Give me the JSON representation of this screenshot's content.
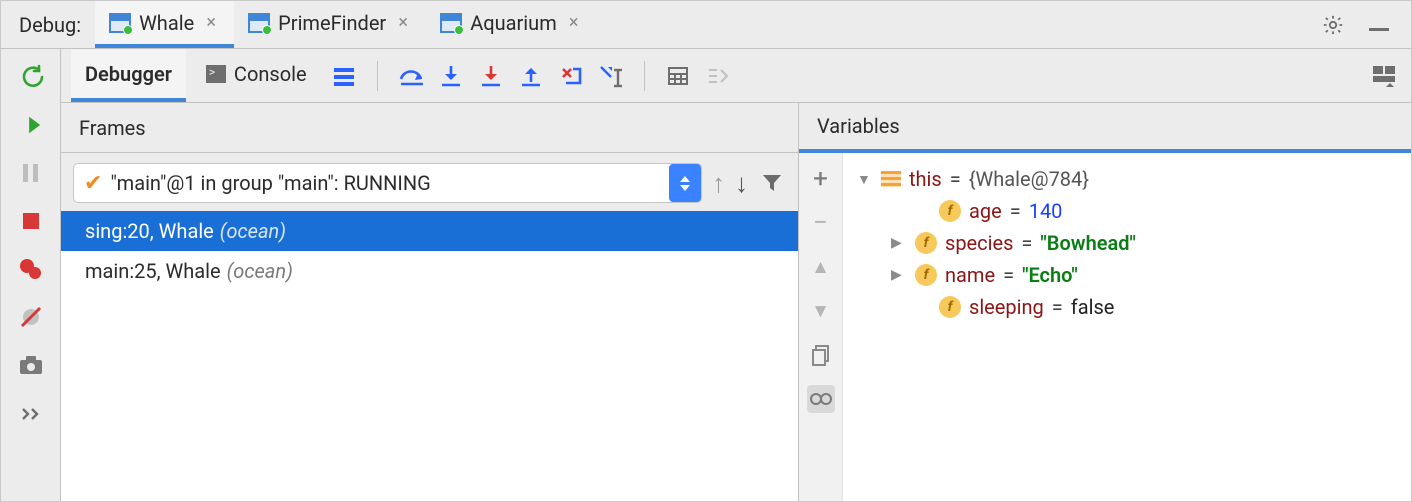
{
  "topbar": {
    "label": "Debug:",
    "tabs": [
      {
        "name": "Whale",
        "active": true
      },
      {
        "name": "PrimeFinder",
        "active": false
      },
      {
        "name": "Aquarium",
        "active": false
      }
    ]
  },
  "subtabs": {
    "debugger": "Debugger",
    "console": "Console"
  },
  "frames": {
    "title": "Frames",
    "thread": "\"main\"@1 in group \"main\": RUNNING",
    "stack": [
      {
        "label": "sing:20, Whale",
        "pkg": "(ocean)",
        "selected": true
      },
      {
        "label": "main:25, Whale",
        "pkg": "(ocean)",
        "selected": false
      }
    ]
  },
  "variables": {
    "title": "Variables",
    "root": {
      "name": "this",
      "value": "{Whale@784}"
    },
    "fields": [
      {
        "name": "age",
        "value": "140",
        "kind": "num",
        "expandable": false
      },
      {
        "name": "species",
        "value": "\"Bowhead\"",
        "kind": "str",
        "expandable": true
      },
      {
        "name": "name",
        "value": "\"Echo\"",
        "kind": "str",
        "expandable": true
      },
      {
        "name": "sleeping",
        "value": "false",
        "kind": "bool",
        "expandable": false
      }
    ]
  }
}
